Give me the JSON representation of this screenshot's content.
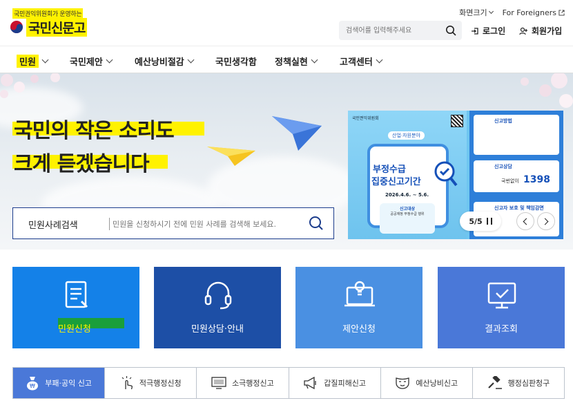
{
  "header": {
    "logo_top": "국민권익위원회가 운영하는",
    "logo_main": "국민신문고",
    "util": {
      "font_size": "화면크기",
      "foreigners": "For Foreigners"
    },
    "search_placeholder": "검색어를 입력해주세요",
    "login": "로그인",
    "join": "회원가입"
  },
  "nav": {
    "items": [
      {
        "label": "민원",
        "has_menu": true,
        "active": true
      },
      {
        "label": "국민제안",
        "has_menu": true
      },
      {
        "label": "예산낭비절감",
        "has_menu": true
      },
      {
        "label": "국민생각함",
        "has_menu": false
      },
      {
        "label": "정책실현",
        "has_menu": true
      },
      {
        "label": "고객센터",
        "has_menu": true
      }
    ]
  },
  "hero": {
    "title_line1": "국민의 작은 소리도",
    "title_line2": "크게 듣겠습니다",
    "search_label": "민원사례검색",
    "search_placeholder": "민원을 신청하시기 전에 민원 사례를 검색해 보세요."
  },
  "banner": {
    "gov": "국민권익위원회",
    "tag": "산업·자원분야",
    "headline1": "부정수급",
    "headline2": "집중신고기간",
    "date": "2026.4.6. ~ 5.6.",
    "target_title": "신고대상",
    "target_text": "공공재정 부정수급 행위",
    "right_method": "신고방법",
    "right_consult": "신고상담",
    "phone_label": "국번없이",
    "phone": "1398",
    "right_protect": "신고자 보호 및 책임감면",
    "pager": "5/5"
  },
  "cards": [
    {
      "label": "민원신청",
      "icon": "document-icon"
    },
    {
      "label": "민원상담·안내",
      "icon": "headset-icon"
    },
    {
      "label": "제안신청",
      "icon": "lightbulb-laptop-icon"
    },
    {
      "label": "결과조회",
      "icon": "monitor-check-icon"
    }
  ],
  "tabs": [
    {
      "label": "부패·공익 신고",
      "icon": "money-bag-icon",
      "active": true
    },
    {
      "label": "적극행정신청",
      "icon": "hand-click-icon"
    },
    {
      "label": "소극행정신고",
      "icon": "monitor-icon"
    },
    {
      "label": "갑질피해신고",
      "icon": "megaphone-icon"
    },
    {
      "label": "예산낭비신고",
      "icon": "mask-icon"
    },
    {
      "label": "행정심판청구",
      "icon": "gavel-icon"
    }
  ]
}
